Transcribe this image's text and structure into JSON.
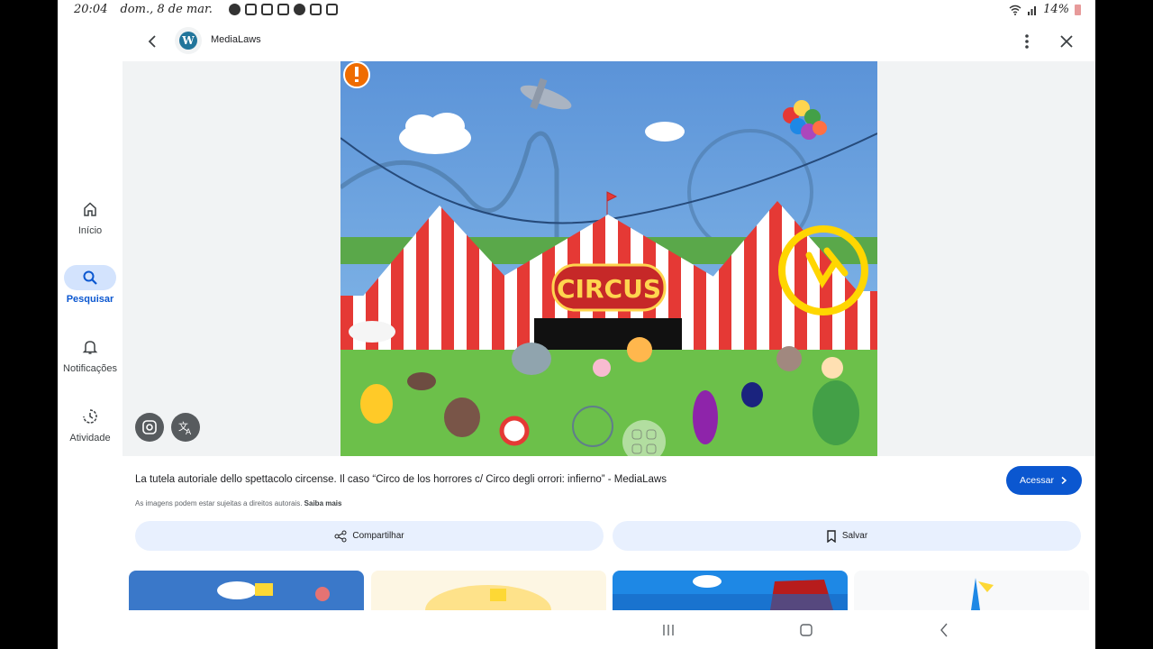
{
  "status_bar": {
    "time": "20:04",
    "date": "dom., 8 de mar.",
    "battery": "14%"
  },
  "header": {
    "site_name": "MediaLaws",
    "logo_letter": "W"
  },
  "rail": {
    "items": [
      {
        "label": "Início",
        "icon": "home-icon"
      },
      {
        "label": "Pesquisar",
        "icon": "search-icon",
        "active": true
      },
      {
        "label": "Notificações",
        "icon": "bell-icon"
      },
      {
        "label": "Atividade",
        "icon": "history-icon"
      }
    ]
  },
  "image": {
    "sign_text": "CIRCUS"
  },
  "result": {
    "caption": "La tutela autoriale dello spettacolo circense. Il caso “Circo de los horrores c/ Circo degli orrori: infierno” - MediaLaws",
    "rights_text": "As imagens podem estar sujeitas a direitos autorais.",
    "rights_link": "Saiba mais",
    "visit_label": "Acessar"
  },
  "actions": {
    "share_label": "Compartilhar",
    "save_label": "Salvar"
  },
  "colors": {
    "accent": "#0b57d0",
    "action_bg": "#e8f0fe",
    "rail_active_bg": "#d3e3fd",
    "sky": "#5b9bd5",
    "tent_red": "#e53935",
    "grass": "#6cc04a"
  }
}
